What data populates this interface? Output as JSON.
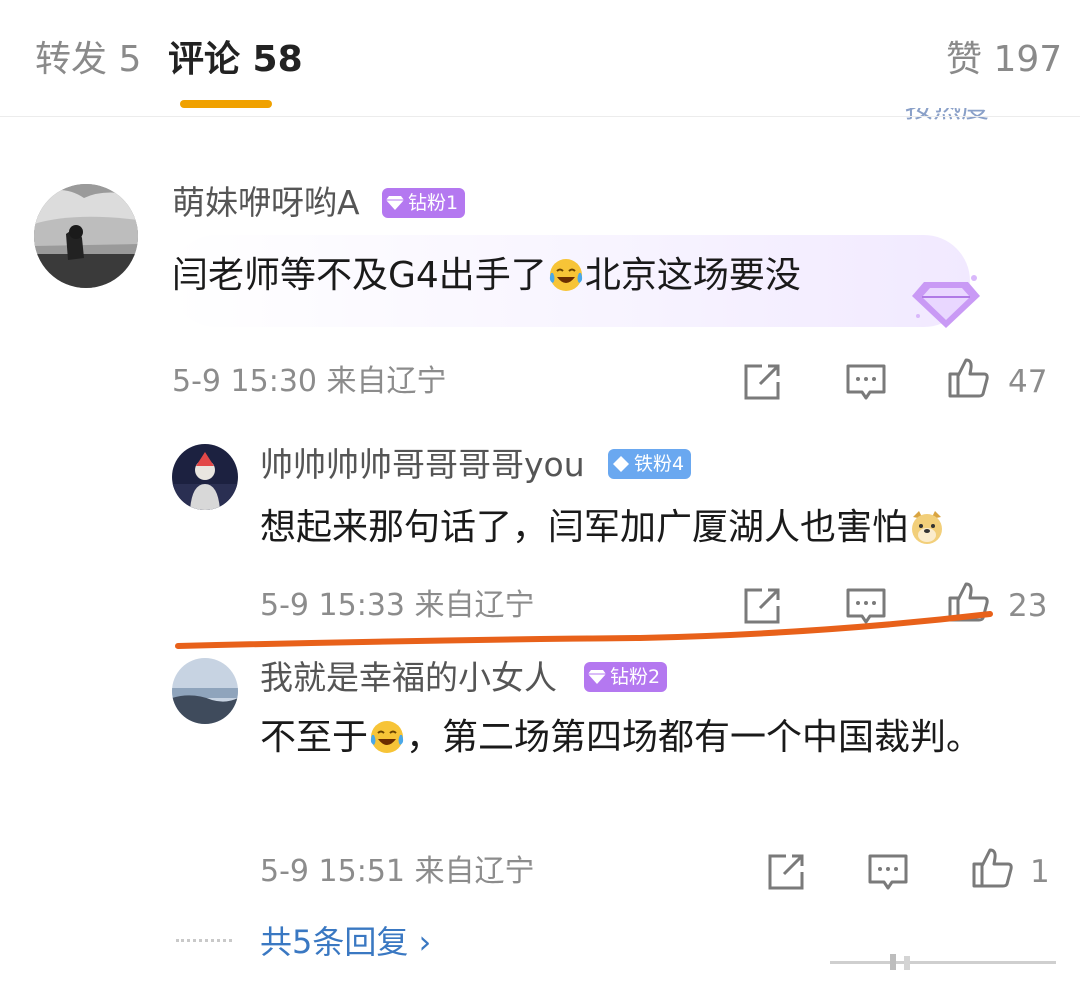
{
  "tabs": {
    "repost": "转发 5",
    "comments": "评论 58",
    "likes": "赞 197",
    "sort_label": "按热度"
  },
  "comments": [
    {
      "username": "萌妹咿呀哟A",
      "badge": "钻粉1",
      "text_before": "闫老师等不及G4出手了",
      "emoji": "laugh-cry-emoji",
      "text_after": "北京这场要没",
      "meta": "5-9 15:30 来自辽宁",
      "likes": "47"
    },
    {
      "username": "帅帅帅帅哥哥哥哥you",
      "badge": "铁粉4",
      "text_before": "想起来那句话了，闫军加广厦湖人也害怕",
      "emoji": "doge-emoji",
      "text_after": "",
      "meta": "5-9 15:33 来自辽宁",
      "likes": "23"
    },
    {
      "username": "我就是幸福的小女人",
      "badge": "钻粉2",
      "text_before": "不至于",
      "emoji": "laugh-cry-emoji",
      "text_after": "，第二场第四场都有一个中国裁判。",
      "meta": "5-9 15:51 来自辽宁",
      "likes": "1"
    }
  ],
  "more_replies": "共5条回复 ›",
  "colors": {
    "tab_accent": "#f0a100",
    "badge_diamond": "#b478f0",
    "badge_iron": "#6aa8f0",
    "link": "#3a78c2",
    "annotation_line": "#e8611a"
  }
}
